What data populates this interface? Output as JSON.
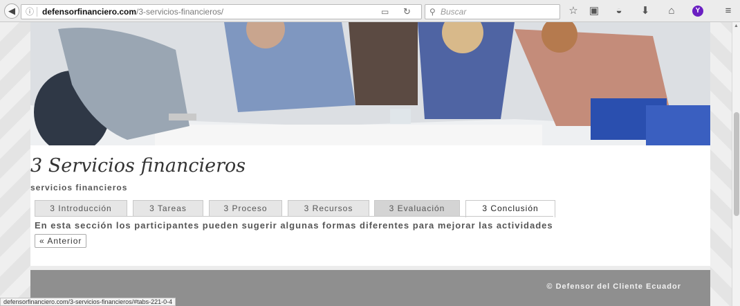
{
  "browser": {
    "url_domain": "defensorfinanciero.com",
    "url_path": "/3-servicios-financieros/",
    "search_placeholder": "Buscar",
    "status_url": "defensorfinanciero.com/3-servicios-financieros/#tabs-221-0-4"
  },
  "page": {
    "title": "3 Servicios financieros",
    "subtitle": "servicios financieros",
    "tabs": [
      {
        "label": "3 Introducción"
      },
      {
        "label": "3 Tareas"
      },
      {
        "label": "3 Proceso"
      },
      {
        "label": "3 Recursos"
      },
      {
        "label": "3 Evaluación"
      },
      {
        "label": "3 Conclusión"
      }
    ],
    "active_tab": "3 Conclusión",
    "tab_content": "En esta sección los participantes pueden sugerir algunas formas diferentes para mejorar las actividades",
    "prev_button": "« Anterior",
    "footer_text": "© Defensor del Cliente Ecuador"
  },
  "colors": {
    "footer_bg": "#8f8f8f",
    "tab_bg": "#e6e6e6",
    "tab_hover_bg": "#d4d4d4",
    "yahoo_purple": "#6a1fc2"
  },
  "icons": [
    "back-arrow-icon",
    "info-icon",
    "reader-view-icon",
    "reload-icon",
    "search-icon",
    "bookmark-star-icon",
    "clipboard-icon",
    "pocket-icon",
    "download-icon",
    "home-icon",
    "yahoo-icon",
    "menu-icon"
  ]
}
